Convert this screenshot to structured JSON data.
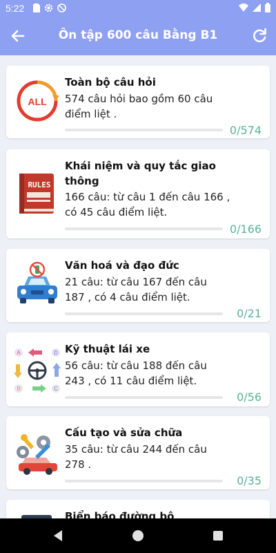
{
  "status": {
    "time": "5:22"
  },
  "header": {
    "title": "Ôn tập 600 câu Bằng B1"
  },
  "colors": {
    "accent": "#8ea0f2",
    "progress": "#5ab394"
  },
  "topics": [
    {
      "title": "Toàn bộ câu hỏi",
      "line1": "574 câu hỏi bao gồm 60 câu",
      "line2": "điểm liệt .",
      "count": "0/574",
      "progress": 0,
      "icon": "all-questions-icon"
    },
    {
      "title_line1": "Khái niệm và quy tắc giao",
      "title_line2": "thông",
      "line1": "166 câu: từ câu 1 đến câu 166 ,",
      "line2": "có 45 câu điểm liệt.",
      "count": "0/166",
      "progress": 0,
      "icon": "rules-book-icon"
    },
    {
      "title": "Văn hoá và đạo đức",
      "line1": "21 câu: từ câu 167 đến câu",
      "line2": "187 , có 4 câu điểm liệt.",
      "count": "0/21",
      "progress": 0,
      "icon": "car-no-alcohol-icon"
    },
    {
      "title": "Kỹ thuật lái xe",
      "line1": "56 câu: từ câu 188 đến câu",
      "line2": "243 , có 11 câu điểm liệt.",
      "count": "0/56",
      "progress": 0,
      "icon": "driving-technique-icon"
    },
    {
      "title": "Cấu tạo và sửa chữa",
      "line1": "35 câu: từ câu 244 đến câu",
      "line2": "278 .",
      "count": "0/35",
      "progress": 0,
      "icon": "car-repair-icon"
    },
    {
      "title": "Biển báo đường bộ",
      "icon": "road-sign-icon"
    }
  ]
}
